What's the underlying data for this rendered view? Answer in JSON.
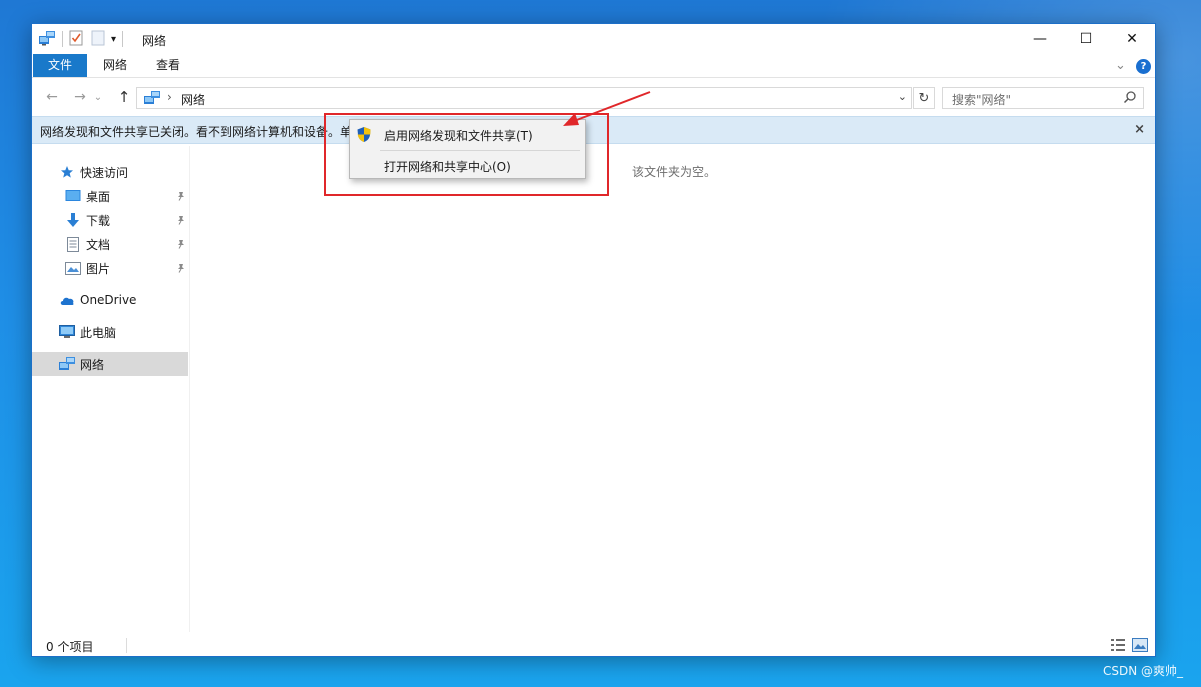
{
  "window": {
    "title": "网络",
    "qat_dropdown": "▾",
    "controls": {
      "minimize": "—",
      "maximize": "☐",
      "close": "✕"
    }
  },
  "ribbon": {
    "tabs": [
      {
        "label": "文件"
      },
      {
        "label": "网络"
      },
      {
        "label": "查看"
      }
    ],
    "expand_icon": "⌄",
    "help_icon": "?"
  },
  "address": {
    "back": "←",
    "forward": "→",
    "recent": "⌄",
    "up": "↑",
    "separator": "›",
    "location": "网络",
    "dropdown": "⌄",
    "refresh": "↻",
    "search_placeholder": "搜索\"网络\""
  },
  "infobar": {
    "message": "网络发现和文件共享已关闭。看不到网络计算机和设备。单",
    "close": "×"
  },
  "sidebar": {
    "quick_access": "快速访问",
    "desktop": "桌面",
    "downloads": "下载",
    "documents": "文档",
    "pictures": "图片",
    "onedrive": "OneDrive",
    "this_pc": "此电脑",
    "network": "网络"
  },
  "main": {
    "empty_text": "该文件夹为空。"
  },
  "context_menu": {
    "items": [
      {
        "label": "启用网络发现和文件共享(T)"
      },
      {
        "label": "打开网络和共享中心(O)"
      }
    ]
  },
  "status": {
    "item_count": "0 个项目"
  },
  "watermark": "CSDN @爽帅_",
  "colors": {
    "accent": "#1979ca",
    "infobar": "#daeaf7",
    "annotation_red": "#e0272a",
    "desktop": "#1f8ee6"
  }
}
